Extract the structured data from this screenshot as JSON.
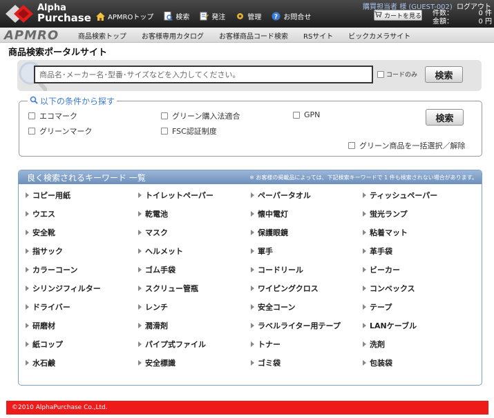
{
  "header": {
    "logo": {
      "line1": "Alpha",
      "line2": "Purchase"
    },
    "nav": [
      {
        "label": "APMROトップ",
        "icon": "home-icon"
      },
      {
        "label": "検索",
        "icon": "search-doc-icon"
      },
      {
        "label": "発注",
        "icon": "order-icon"
      },
      {
        "label": "管理",
        "icon": "manage-gear-icon"
      },
      {
        "label": "お問合せ",
        "icon": "help-icon"
      }
    ],
    "user": "購買担当者 様 (GUEST-002)",
    "logout": "ログアウト",
    "cart_button": "カートを見る",
    "cart": {
      "count_label": "件数：",
      "count_value": "0 件",
      "amount_label": "金額：",
      "amount_value": "0 円"
    }
  },
  "subnav": {
    "brand": "APMRO",
    "items": [
      "商品検索トップ",
      "お客様専用カタログ",
      "お客様商品コード検索",
      "RSサイト",
      "ビックカメラサイト"
    ]
  },
  "page_title": "商品検索ポータルサイト",
  "search": {
    "placeholder": "商品名･メーカー名･型番･サイズなどを入力してください。",
    "code_only": "コードのみ",
    "button": "検索"
  },
  "conditions": {
    "title": "以下の条件から探す",
    "items": [
      "エコマーク",
      "グリーンマーク",
      "グリーン購入法適合",
      "FSC認証制度",
      "GPN"
    ],
    "select_all": "グリーン商品を一括選択／解除",
    "button": "検索"
  },
  "keywords": {
    "title": "良く検索されるキーワード 一覧",
    "note": "※ お客様の掲載品によっては、下記検索キーワードで 1 件も検索されない場合があります。",
    "items": [
      "コピー用紙",
      "トイレットペーパー",
      "ペーパータオル",
      "ティッシュペーパー",
      "ウエス",
      "乾電池",
      "懐中電灯",
      "蛍光ランプ",
      "安全靴",
      "マスク",
      "保護眼鏡",
      "粘着マット",
      "指サック",
      "ヘルメット",
      "軍手",
      "革手袋",
      "カラーコーン",
      "ゴム手袋",
      "コードリール",
      "ビーカー",
      "シリンジフィルター",
      "スクリュー管瓶",
      "ワイピングクロス",
      "コンベックス",
      "ドライバー",
      "レンチ",
      "安全コーン",
      "テープ",
      "研磨材",
      "潤滑剤",
      "ラベルライター用テープ",
      "LANケーブル",
      "紙コップ",
      "パイプ式ファイル",
      "トナー",
      "洗剤",
      "水石鹸",
      "安全標識",
      "ゴミ袋",
      "包装袋"
    ]
  },
  "footer": "©2010 AlphaPurchase Co.,Ltd."
}
